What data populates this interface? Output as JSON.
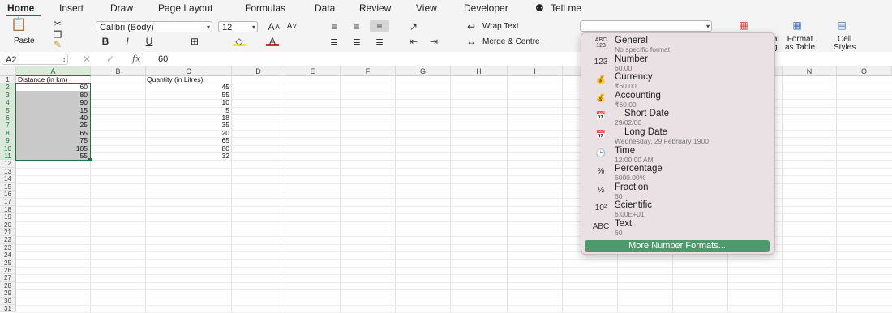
{
  "tabs": [
    "Home",
    "Insert",
    "Draw",
    "Page Layout",
    "Formulas",
    "Data",
    "Review",
    "View",
    "Developer",
    "Tell me"
  ],
  "ribbon": {
    "paste": "Paste",
    "font_name": "Calibri (Body)",
    "font_size": "12",
    "bold": "B",
    "italic": "I",
    "underline": "U",
    "wrap_text": "Wrap Text",
    "merge_centre": "Merge & Centre",
    "number_format_value": "",
    "cond_fmt_label_tail": "al\ng",
    "format_as_table": "Format\nas Table",
    "cell_styles": "Cell\nStyles"
  },
  "formula_bar": {
    "name_box": "A2",
    "fx": "fx",
    "value": "60"
  },
  "columns": [
    "A",
    "B",
    "C",
    "D",
    "E",
    "F",
    "G",
    "H",
    "I",
    "J",
    "K",
    "L",
    "M",
    "N",
    "O"
  ],
  "rows": [
    "1",
    "2",
    "3",
    "4",
    "5",
    "6",
    "7",
    "8",
    "9",
    "10",
    "11",
    "12",
    "13",
    "14",
    "15",
    "16",
    "17",
    "18",
    "19",
    "20",
    "21",
    "22",
    "23",
    "24",
    "25",
    "26",
    "27",
    "28",
    "29",
    "30",
    "31"
  ],
  "sheet": {
    "a1": "Distance (in km)",
    "c1": "Quantity (in Litres)",
    "col_a": [
      "60",
      "80",
      "90",
      "15",
      "40",
      "25",
      "65",
      "75",
      "105",
      "55"
    ],
    "col_c": [
      "45",
      "55",
      "10",
      "5",
      "18",
      "35",
      "20",
      "65",
      "80",
      "32"
    ]
  },
  "number_formats": [
    {
      "icon": "ABC 123",
      "name": "General",
      "sample": "No specific format"
    },
    {
      "icon": "123",
      "name": "Number",
      "sample": "60.00"
    },
    {
      "icon": "coins-icon",
      "name": "Currency",
      "sample": "₹60.00"
    },
    {
      "icon": "coins-icon",
      "name": "Accounting",
      "sample": "₹60.00"
    },
    {
      "icon": "calendar-icon",
      "name": "Short Date",
      "sample": "29/02/00"
    },
    {
      "icon": "calendar-icon",
      "name": "Long Date",
      "sample": "Wednesday, 29 February 1900"
    },
    {
      "icon": "clock-icon",
      "name": "Time",
      "sample": "12:00:00 AM"
    },
    {
      "icon": "%",
      "name": "Percentage",
      "sample": "6000.00%"
    },
    {
      "icon": "½",
      "name": "Fraction",
      "sample": "60"
    },
    {
      "icon": "10²",
      "name": "Scientific",
      "sample": "6.00E+01"
    },
    {
      "icon": "ABC",
      "name": "Text",
      "sample": "60"
    }
  ],
  "more_formats": "More Number Formats..."
}
